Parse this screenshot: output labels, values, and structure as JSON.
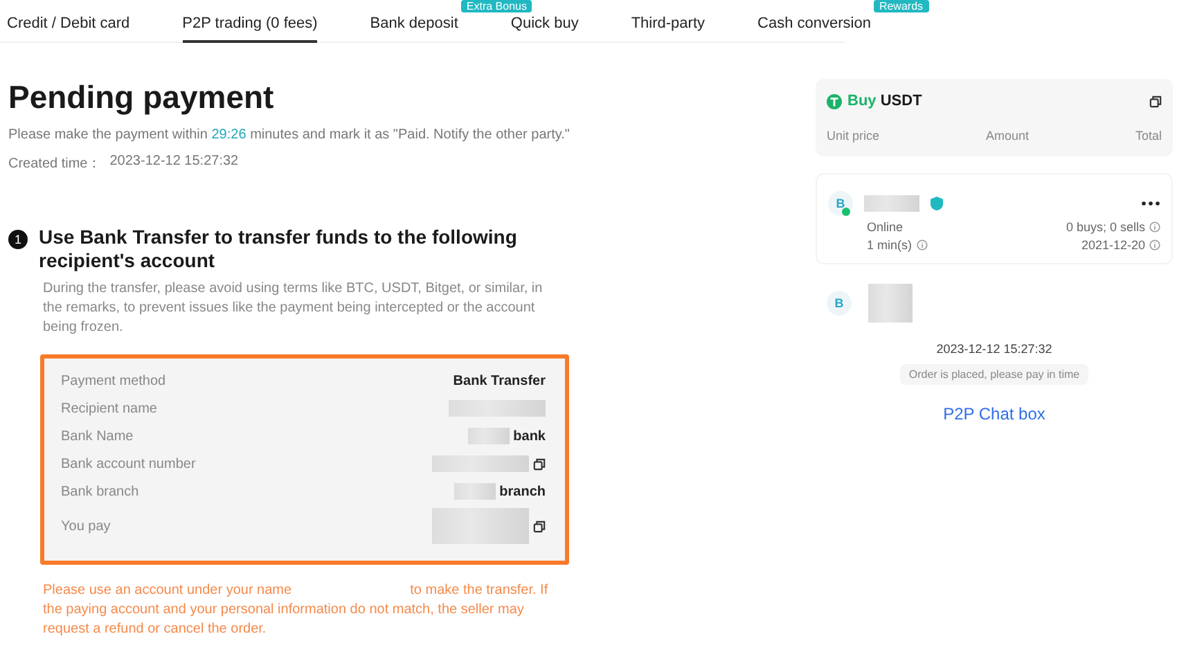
{
  "tabs": [
    {
      "label": "Credit / Debit card",
      "selected": false
    },
    {
      "label": "P2P trading (0 fees)",
      "selected": true
    },
    {
      "label": "Bank deposit",
      "selected": false,
      "badge": "Extra Bonus"
    },
    {
      "label": "Quick buy",
      "selected": false
    },
    {
      "label": "Third-party",
      "selected": false
    },
    {
      "label": "Cash conversion",
      "selected": false,
      "badge": "Rewards"
    }
  ],
  "title": "Pending payment",
  "notice": {
    "before": "Please make the payment within",
    "timer": "29:26",
    "after": "minutes and mark it as \"Paid. Notify the other party.\""
  },
  "created": {
    "label": "Created time：",
    "value": "2023-12-12 15:27:32"
  },
  "step": {
    "number": "1",
    "title": "Use Bank Transfer to transfer funds to the following recipient's account",
    "hint": "During the transfer, please avoid using terms like BTC, USDT, Bitget, or similar, in the remarks, to prevent issues like the payment being intercepted or the account being frozen."
  },
  "details": [
    {
      "label": "Payment method",
      "value": "Bank Transfer",
      "blurred": false,
      "copy": false
    },
    {
      "label": "Recipient name",
      "blurred": true,
      "copy": false
    },
    {
      "label": "Bank Name",
      "value": "bank",
      "blurred": true,
      "copy": false
    },
    {
      "label": "Bank account number",
      "blurred": true,
      "copy": true
    },
    {
      "label": "Bank branch",
      "value": "branch",
      "blurred": true,
      "copy": false
    },
    {
      "label": "You pay",
      "blurred": true,
      "copy": true,
      "tall": true
    }
  ],
  "warning": {
    "before": "Please use an account under your name",
    "after": "to make the transfer. If the paying account and your personal information do not match, the seller may request a refund or cancel the order."
  },
  "order": {
    "action": "Buy",
    "asset": "USDT",
    "columns": [
      "Unit price",
      "Amount",
      "Total"
    ]
  },
  "seller": {
    "avatar": "B",
    "status": "Online",
    "response": "1 min(s)",
    "trades": "0 buys; 0 sells",
    "joined": "2021-12-20",
    "online": true
  },
  "chat": {
    "avatar": "B",
    "time": "2023-12-12 15:27:32",
    "system": "Order is placed, please pay in time",
    "caption": "P2P Chat box"
  }
}
